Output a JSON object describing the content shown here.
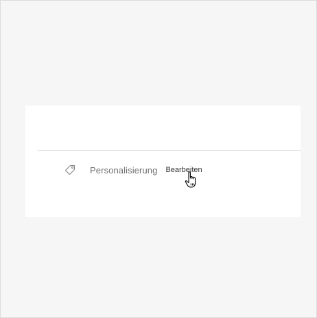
{
  "personalization_row": {
    "label": "Personalisierung",
    "edit_label": "Bearbeiten",
    "icon": "tag-icon"
  },
  "cursor": {
    "icon": "hand-pointer-icon"
  }
}
